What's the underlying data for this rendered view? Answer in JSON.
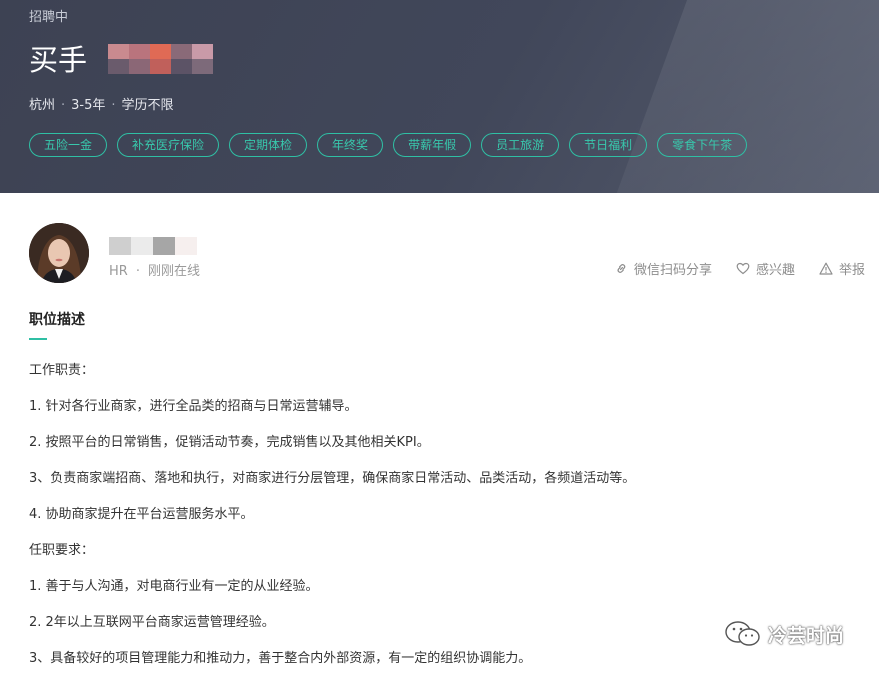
{
  "header": {
    "status": "招聘中",
    "job_title": "买手",
    "meta": {
      "city": "杭州",
      "experience": "3-5年",
      "education": "学历不限"
    },
    "benefits": [
      "五险一金",
      "补充医疗保险",
      "定期体检",
      "年终奖",
      "带薪年假",
      "员工旅游",
      "节日福利",
      "零食下午茶"
    ],
    "colors": {
      "background": "#41475a",
      "tag_accent": "#2fbfa4"
    }
  },
  "recruiter": {
    "role": "HR",
    "online_status": "刚刚在线",
    "actions": {
      "share": "微信扫码分享",
      "interest": "感兴趣",
      "report": "举报"
    }
  },
  "description": {
    "title": "职位描述",
    "lines": [
      "工作职责：",
      "1. 针对各行业商家，进行全品类的招商与日常运营辅导。",
      "2. 按照平台的日常销售，促销活动节奏，完成销售以及其他相关KPI。",
      "3、负责商家端招商、落地和执行，对商家进行分层管理，确保商家日常活动、品类活动，各频道活动等。",
      "4. 协助商家提升在平台运营服务水平。",
      "任职要求：",
      "1. 善于与人沟通，对电商行业有一定的从业经验。",
      "2. 2年以上互联网平台商家运营管理经验。",
      "3、具备较好的项目管理能力和推动力，善于整合内外部资源，有一定的组织协调能力。"
    ]
  },
  "watermark": {
    "text": "冷芸时尚",
    "icon": "wechat-icon"
  }
}
